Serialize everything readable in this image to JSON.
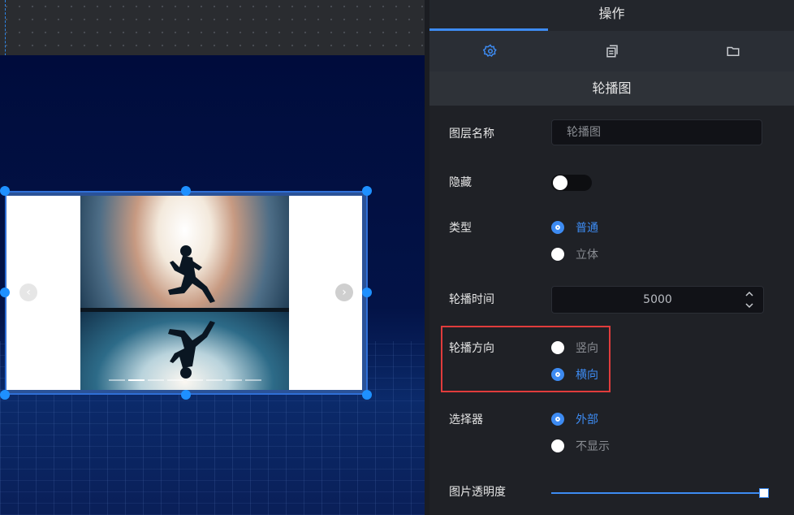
{
  "panel": {
    "title": "操作",
    "tabs": [
      {
        "icon": "gear-icon"
      },
      {
        "icon": "copy-icon"
      },
      {
        "icon": "folder-icon"
      }
    ],
    "section_title": "轮播图"
  },
  "form": {
    "layer_name": {
      "label": "图层名称",
      "placeholder": "轮播图"
    },
    "hidden": {
      "label": "隐藏",
      "value": false
    },
    "type": {
      "label": "类型",
      "options": [
        "普通",
        "立体"
      ],
      "selected": "普通"
    },
    "interval": {
      "label": "轮播时间",
      "value": "5000"
    },
    "direction": {
      "label": "轮播方向",
      "options": [
        "竖向",
        "横向"
      ],
      "selected": "横向"
    },
    "indicator": {
      "label": "选择器",
      "options": [
        "外部",
        "不显示"
      ],
      "selected": "外部"
    },
    "opacity": {
      "label": "图片透明度",
      "value": 1
    }
  },
  "colors": {
    "accent": "#3d8bf2",
    "highlight": "#e03c3c",
    "handle": "#1e90ff"
  },
  "canvas": {
    "carousel": {
      "prev_icon": "chevron-left-icon",
      "next_icon": "chevron-right-icon",
      "indicator_count": 8,
      "active_indicator": 2
    }
  }
}
